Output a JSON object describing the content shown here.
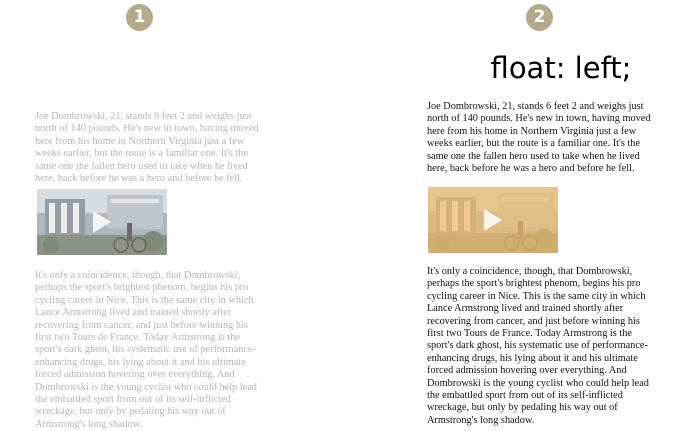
{
  "panel1": {
    "badge": "1",
    "para1": "Joe Dombrowski, 21, stands 6 feet 2 and weighs just north of 140 pounds. He's new in town, having moved here from his home in Northern Virginia just a few weeks earlier, but the route is a familiar one. It's the same one the fallen hero used to take when he lived here, back before he was a hero and before he fell.",
    "para2": "It's only a coincidence, though, that Dombrowski, perhaps the sport's brightest phenom, begins his pro cycling career in Nice. This is the same city in which Lance Armstrong lived and trained shortly after recovering from cancer, and just before winning his first two Tours de France. Today Armstrong is the sport's dark ghost, his systematic use of performance-enhancing drugs, his lying about it and his ultimate forced admission hovering over everything. And Dombrowski is the young cyclist who could help lead the embattled sport from out of its self-inflicted wreckage, but only by pedaling his way out of Armstrong's long shadow."
  },
  "panel2": {
    "badge": "2",
    "title": "float: left;",
    "para1": "Joe Dombrowski, 21, stands 6 feet 2 and weighs just north of 140 pounds. He's new in town, having moved here from his home in Northern Virginia just a few weeks earlier, but the route is a familiar one. It's the same one the fallen hero used to take when he lived here, back before he was a hero and before he fell.",
    "para2": "It's only a coincidence, though, that Dombrowski, perhaps the sport's brightest phenom, begins his pro cycling career in Nice. This is the same city in which Lance Armstrong lived and trained shortly after recovering from cancer, and just before winning his first two Tours de France. Today Armstrong is the sport's dark ghost, his systematic use of performance-enhancing drugs, his lying about it and his ultimate forced admission hovering over everything. And Dombrowski is the young cyclist who could help lead the embattled sport from out of its self-inflicted wreckage, but only by pedaling his way out of Armstrong's long shadow."
  },
  "colors": {
    "badge": "#b3a98c",
    "faded_text": "#b5b5b5",
    "float_highlight": "#f0c27a"
  },
  "icons": [
    "play-icon"
  ]
}
